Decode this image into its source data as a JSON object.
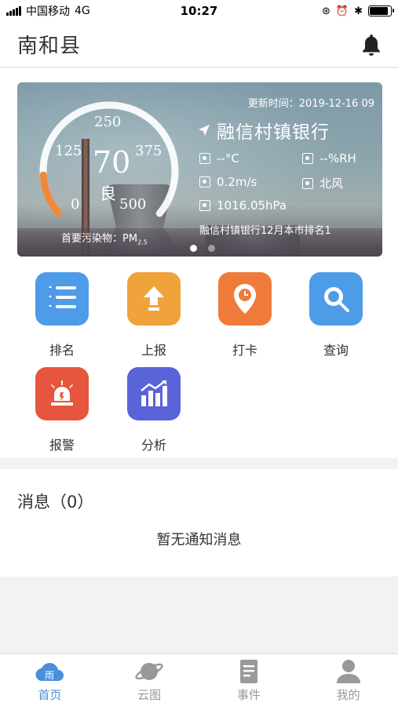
{
  "status_bar": {
    "carrier": "中国移动",
    "network": "4G",
    "time": "10:27"
  },
  "header": {
    "title": "南和县",
    "icon": "bell-icon"
  },
  "banner": {
    "update_time": "更新时间：2019-12-16 09",
    "bank_name": "融信村镇银行",
    "aqi": {
      "value": "70",
      "level": "良",
      "ticks": [
        "0",
        "125",
        "250",
        "375",
        "500"
      ],
      "pollutant_label": "首要污染物：",
      "pollutant": "PM",
      "pollutant_sub": "2.5",
      "max": 500
    },
    "weather": {
      "temperature": "--°C",
      "humidity": "--%RH",
      "wind_speed": "0.2m/s",
      "wind_direction": "北风",
      "pressure": "1016.05hPa"
    },
    "rank_text": "融信村镇银行12月本市排名1",
    "active_slide": 0
  },
  "functions": [
    {
      "label": "排名",
      "icon": "list-icon",
      "color": "#4e9be8"
    },
    {
      "label": "上报",
      "icon": "upload-icon",
      "color": "#f0a23b"
    },
    {
      "label": "打卡",
      "icon": "location-clock-icon",
      "color": "#ef7a3a"
    },
    {
      "label": "查询",
      "icon": "search-icon",
      "color": "#4e9be8"
    },
    {
      "label": "报警",
      "icon": "alarm-icon",
      "color": "#e6553d"
    },
    {
      "label": "分析",
      "icon": "chart-icon",
      "color": "#5a63d8"
    }
  ],
  "messages": {
    "title": "消息（0）",
    "empty_text": "暂无通知消息"
  },
  "tabbar": {
    "items": [
      {
        "label": "首页",
        "icon": "home-cloud-icon",
        "badge": "雨"
      },
      {
        "label": "云图",
        "icon": "planet-icon"
      },
      {
        "label": "事件",
        "icon": "document-icon"
      },
      {
        "label": "我的",
        "icon": "person-icon"
      }
    ],
    "active_index": 0
  }
}
